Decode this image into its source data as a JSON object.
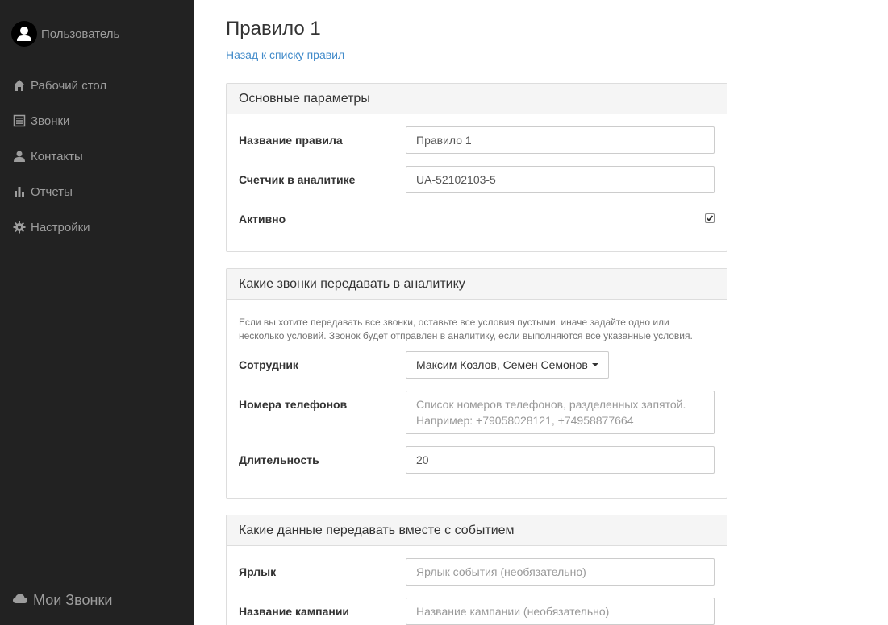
{
  "sidebar": {
    "user_name": "Пользователь",
    "items": [
      {
        "label": "Рабочий стол",
        "icon": "home-icon"
      },
      {
        "label": "Звонки",
        "icon": "list-icon"
      },
      {
        "label": "Контакты",
        "icon": "user-icon"
      },
      {
        "label": "Отчеты",
        "icon": "bar-chart-icon"
      },
      {
        "label": "Настройки",
        "icon": "gear-icon"
      }
    ],
    "brand": "Мои Звонки"
  },
  "page": {
    "title": "Правило 1",
    "back_link": "Назад к списку правил"
  },
  "panel_main": {
    "heading": "Основные параметры",
    "name_label": "Название правила",
    "name_value": "Правило 1",
    "counter_label": "Счетчик в аналитике",
    "counter_value": "UA-52102103-5",
    "active_label": "Активно",
    "active_checked": true
  },
  "panel_calls": {
    "heading": "Какие звонки передавать в аналитику",
    "help": "Если вы хотите передавать все звонки, оставьте все условия пустыми, иначе задайте одно или несколько условий. Звонок будет отправлен в аналитику, если выполняются все указанные условия.",
    "employee_label": "Сотрудник",
    "employee_value": "Максим Козлов, Семен Семонов",
    "phones_label": "Номера телефонов",
    "phones_placeholder": "Список номеров телефонов, разделенных запятой. Например: +79058028121, +74958877664",
    "duration_label": "Длительность",
    "duration_value": "20"
  },
  "panel_data": {
    "heading": "Какие данные передавать вместе с событием",
    "label_label": "Ярлык",
    "label_placeholder": "Ярлык события (необязательно)",
    "campaign_label": "Название кампании",
    "campaign_placeholder": "Название кампании (необязательно)"
  }
}
